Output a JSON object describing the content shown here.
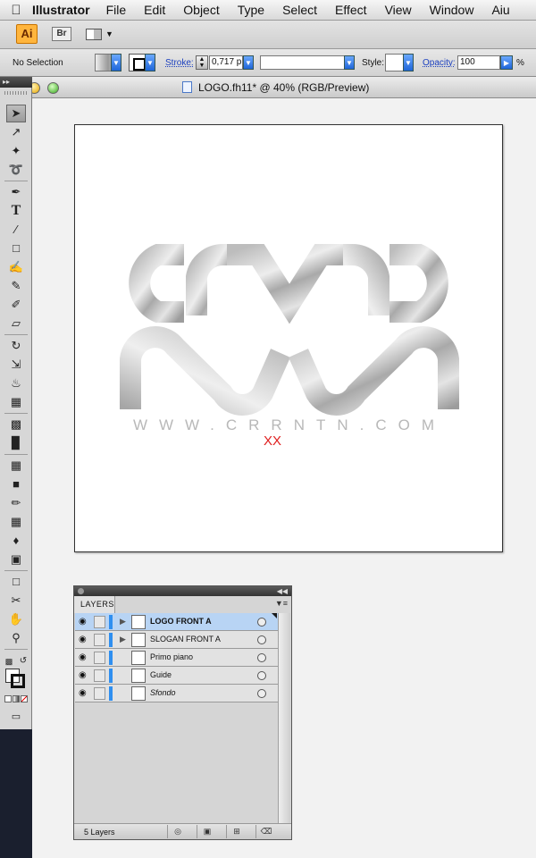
{
  "menubar": {
    "apple_icon": "apple-icon",
    "app_name": "Illustrator",
    "items": [
      "File",
      "Edit",
      "Object",
      "Type",
      "Select",
      "Effect",
      "View",
      "Window",
      "Aiu"
    ]
  },
  "appbar": {
    "logo": "Ai",
    "bridge": "Br",
    "arrange_icon": "arrange-documents-icon"
  },
  "control": {
    "selection": "No Selection",
    "stroke_label": "Stroke:",
    "stroke_value": "0,717 p",
    "style_label": "Style:",
    "opacity_label": "Opacity:",
    "opacity_value": "100",
    "opacity_unit": "%"
  },
  "document": {
    "title": "LOGO.fh11* @ 40% (RGB/Preview)",
    "artboard": {
      "logo_text": "WWW.CRRNTN.COM",
      "overlay_text": "XX",
      "overlay_color": "#e02020"
    }
  },
  "layers": {
    "tab_label": "LAYERS",
    "rows": [
      {
        "name": "LOGO FRONT A",
        "selected": true,
        "has_children": true
      },
      {
        "name": "SLOGAN FRONT A",
        "selected": false,
        "has_children": true
      },
      {
        "name": "Primo piano",
        "selected": false,
        "has_children": false
      },
      {
        "name": "Guide",
        "selected": false,
        "has_children": false
      },
      {
        "name": "Sfondo",
        "selected": false,
        "has_children": false
      }
    ],
    "count": "5 Layers",
    "layer_color": "#2f8ff0"
  }
}
